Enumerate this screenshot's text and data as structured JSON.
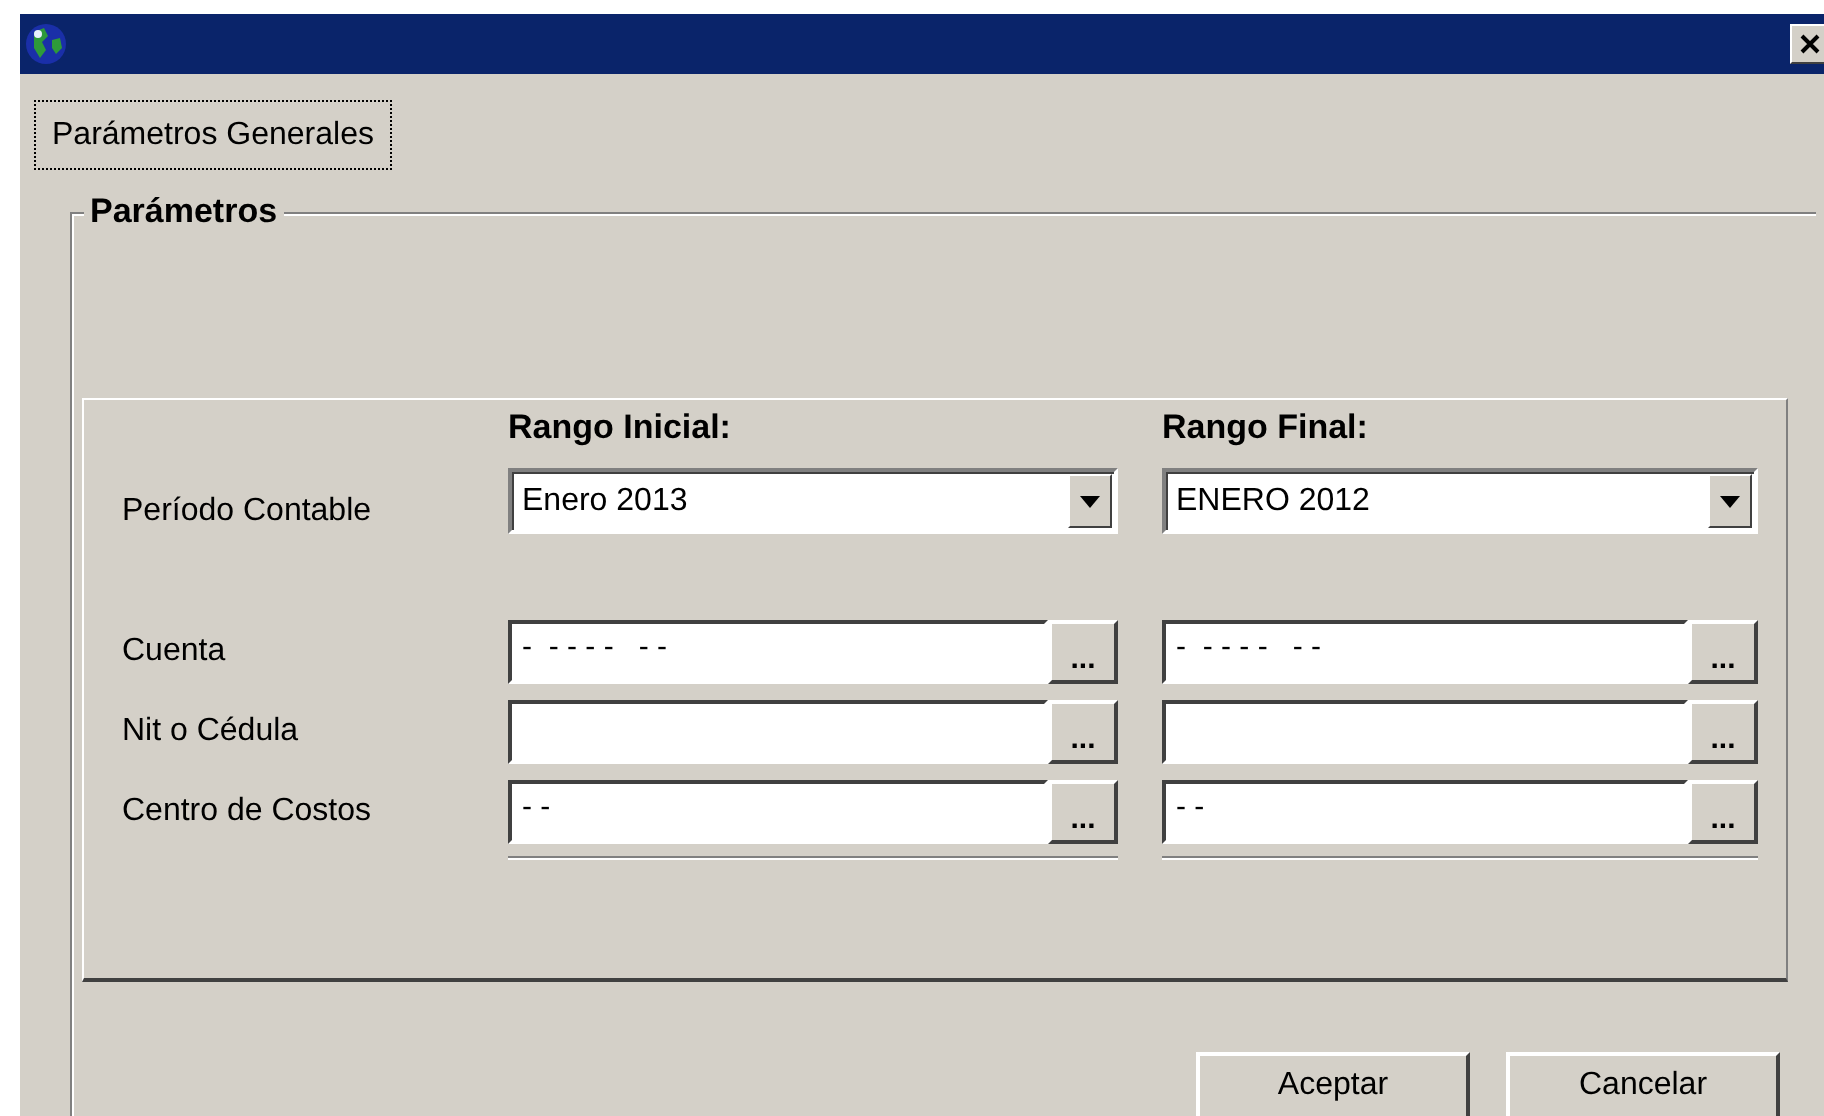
{
  "tabs": [
    {
      "label": "Parámetros Generales",
      "selected": true
    }
  ],
  "group": {
    "legend": "Parámetros"
  },
  "range_headers": [
    "Rango Inicial:",
    "Rango Final:"
  ],
  "rows": [
    {
      "kind": "combo",
      "label": "Período Contable",
      "values": [
        "Enero 2013",
        "ENERO 2012"
      ]
    },
    {
      "kind": "lookup",
      "label": "Cuenta",
      "values": [
        "-  - - - -   - -",
        "-  - - - -   - -"
      ]
    },
    {
      "kind": "lookup",
      "label": "Nit o Cédula"
    },
    {
      "kind": "lookup",
      "label": "Centro de Costos",
      "values": [
        "- -",
        "- -"
      ]
    }
  ],
  "lookup_button": "...",
  "buttons": [
    "Aceptar",
    "Cancelar"
  ]
}
